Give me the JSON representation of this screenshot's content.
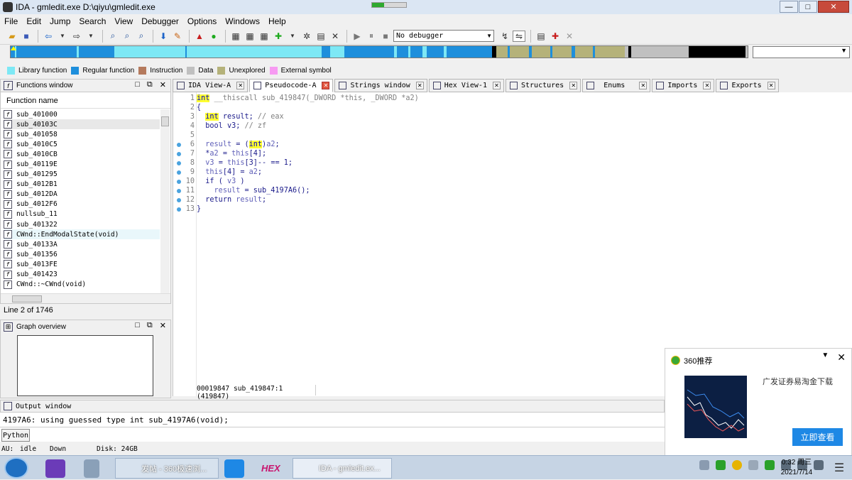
{
  "window": {
    "title": "IDA - gmledit.exe D:\\qiyu\\gmledit.exe",
    "progress_fraction": 0.35,
    "buttons": {
      "minimize": "—",
      "maximize": "□",
      "close": "✕"
    }
  },
  "menu": [
    "File",
    "Edit",
    "Jump",
    "Search",
    "View",
    "Debugger",
    "Options",
    "Windows",
    "Help"
  ],
  "toolbar": {
    "debugger_select": "No debugger"
  },
  "legend": [
    {
      "label": "Library function",
      "color": "#7de8f5"
    },
    {
      "label": "Regular function",
      "color": "#1e8fdc"
    },
    {
      "label": "Instruction",
      "color": "#b57a5d"
    },
    {
      "label": "Data",
      "color": "#c0c0c0"
    },
    {
      "label": "Unexplored",
      "color": "#b5b27a"
    },
    {
      "label": "External symbol",
      "color": "#f79af2"
    }
  ],
  "functions_window": {
    "title": "Functions window",
    "column_header": "Function name",
    "items": [
      "sub_401000",
      "sub_40103C",
      "sub_401058",
      "sub_4010C5",
      "sub_4010CB",
      "sub_40119E",
      "sub_401295",
      "sub_4012B1",
      "sub_4012DA",
      "sub_4012F6",
      "nullsub_11",
      "sub_401322",
      "CWnd::EndModalState(void)",
      "sub_40133A",
      "sub_401356",
      "sub_4013FE",
      "sub_401423",
      "CWnd::~CWnd(void)"
    ],
    "selected_index": 1,
    "highlight_index": 12,
    "line_info": "Line 2 of 1746"
  },
  "graph_overview": {
    "title": "Graph overview"
  },
  "tabs": [
    {
      "label": "IDA View-A",
      "active": false
    },
    {
      "label": "Pseudocode-A",
      "active": true
    },
    {
      "label": "Strings window",
      "active": false
    },
    {
      "label": "Hex View-1",
      "active": false
    },
    {
      "label": "Structures",
      "active": false
    },
    {
      "label": "Enums",
      "active": false
    },
    {
      "label": "Imports",
      "active": false
    },
    {
      "label": "Exports",
      "active": false
    }
  ],
  "pseudocode": {
    "lines": [
      {
        "n": "1",
        "dot": false
      },
      {
        "n": "2",
        "dot": false
      },
      {
        "n": "3",
        "dot": false
      },
      {
        "n": "4",
        "dot": false
      },
      {
        "n": "5",
        "dot": false
      },
      {
        "n": "6",
        "dot": true
      },
      {
        "n": "7",
        "dot": true
      },
      {
        "n": "8",
        "dot": true
      },
      {
        "n": "9",
        "dot": true
      },
      {
        "n": "10",
        "dot": true
      },
      {
        "n": "11",
        "dot": true
      },
      {
        "n": "12",
        "dot": true
      },
      {
        "n": "13",
        "dot": true
      }
    ],
    "tokens": {
      "l1_int": "int",
      "l1_rest": " __thiscall sub_419847(_DWORD *this, _DWORD *a2)",
      "l2": "{",
      "l3_int": "int",
      "l3_rest": " result; ",
      "l3_cmt": "// eax",
      "l4_kw": "bool",
      "l4_var": " v3; ",
      "l4_cmt": "// zf",
      "l6_a": "result",
      "l6_b": " = (",
      "l6_int": "int",
      "l6_c": ")",
      "l6_d": "a2",
      "l6_e": ";",
      "l7_a": "*",
      "l7_b": "a2",
      "l7_c": " = ",
      "l7_d": "this",
      "l7_e": "[4];",
      "l8_a": "v3",
      "l8_b": " = ",
      "l8_c": "this",
      "l8_d": "[3]-- == 1;",
      "l9_a": "this",
      "l9_b": "[4] = ",
      "l9_c": "a2",
      "l9_d": ";",
      "l10_a": "if",
      "l10_b": " ( ",
      "l10_c": "v3",
      "l10_d": " )",
      "l11_a": "result",
      "l11_b": " = sub_4197A6();",
      "l12_a": "return",
      "l12_b": " ",
      "l12_c": "result",
      "l12_d": ";",
      "l13": "}"
    },
    "status": "00019847 sub_419847:1 (419847)"
  },
  "output": {
    "title": "Output window",
    "line": "4197A6: using guessed type int sub_4197A6(void);",
    "python_button": "Python"
  },
  "statusbar": {
    "au_label": "AU:",
    "au_state": "idle",
    "direction": "Down",
    "disk": "Disk: 24GB"
  },
  "popup": {
    "title": "360推荐",
    "description": "广发证券易淘金下载",
    "cta": "立即查看"
  },
  "taskbar": {
    "tasks": [
      {
        "label": "发帖 - 360极速浏..."
      },
      {
        "label": "IDA - gmledit.ex..."
      }
    ],
    "hex_icon_text": "HEX",
    "clock_time": "0:32 周三",
    "clock_date": "2021/7/14"
  }
}
